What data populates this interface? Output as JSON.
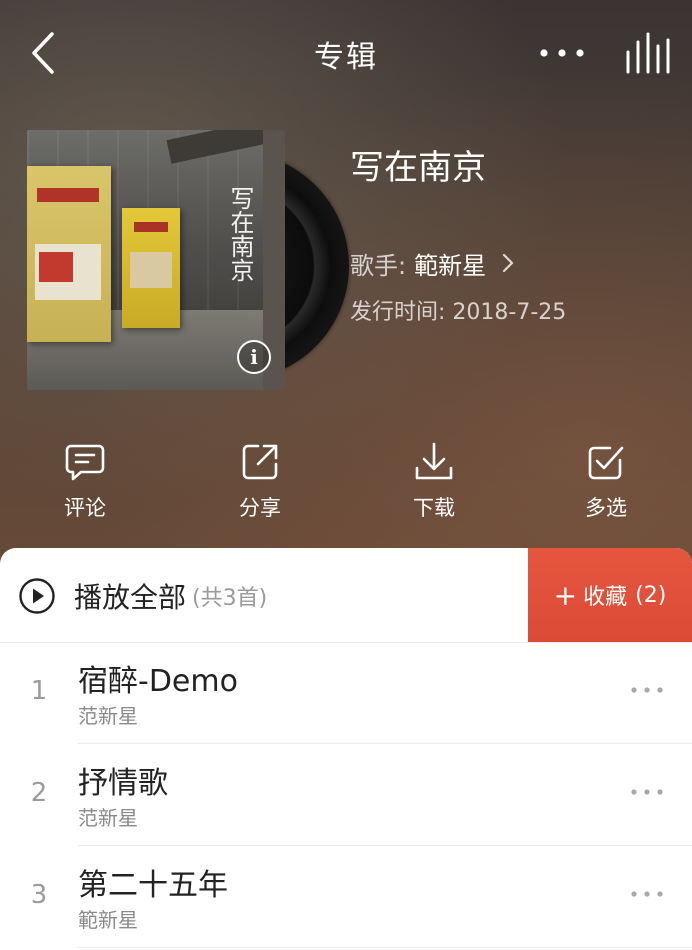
{
  "header": {
    "title": "专辑",
    "back_icon": "back-arrow-icon",
    "more_icon": "more-horizontal-icon",
    "now_playing_icon": "equalizer-bars-icon"
  },
  "album": {
    "name": "写在南京",
    "cover_text": "写在南京",
    "info_icon_label": "i",
    "artist_label": "歌手:",
    "artist_name": "範新星",
    "release_label": "发行时间:",
    "release_date": "2018-7-25"
  },
  "actions": [
    {
      "label": "评论",
      "icon": "comment-icon"
    },
    {
      "label": "分享",
      "icon": "share-icon"
    },
    {
      "label": "下载",
      "icon": "download-icon"
    },
    {
      "label": "多选",
      "icon": "multi-select-icon"
    }
  ],
  "playlist": {
    "play_all_label": "播放全部",
    "count_label": "(共3首)",
    "collect_label": "收藏",
    "collect_plus": "+",
    "collect_count": "(2)"
  },
  "songs": [
    {
      "index": "1",
      "title": "宿醉-Demo",
      "artist": "范新星"
    },
    {
      "index": "2",
      "title": "抒情歌",
      "artist": "范新星"
    },
    {
      "index": "3",
      "title": "第二十五年",
      "artist": "範新星"
    }
  ],
  "colors": {
    "accent": "#dc4a36",
    "text_primary": "#222222",
    "text_secondary": "#8a8a8a"
  }
}
